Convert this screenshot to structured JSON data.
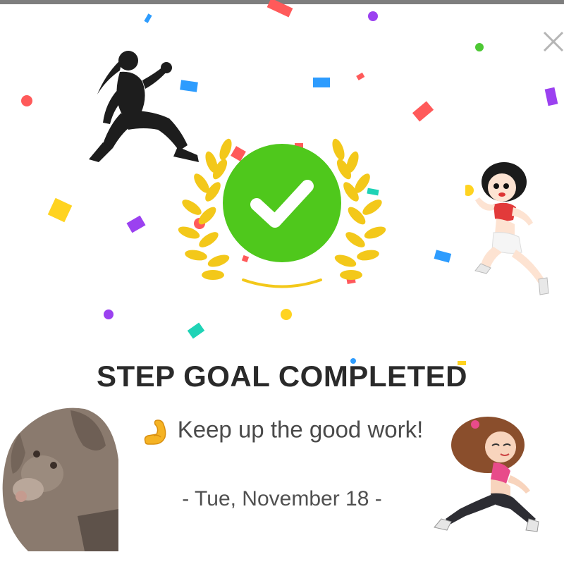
{
  "dialog": {
    "title": "STEP GOAL COMPLETED",
    "message": "Keep up the good work!",
    "date": "- Tue, November 18 -",
    "icons": {
      "close": "close-icon",
      "emoji": "flexed-biceps-emoji",
      "badge": "green-check-laurel-badge"
    }
  },
  "colors": {
    "check_green": "#4fc81c",
    "laurel_gold": "#f3c81a",
    "title_text": "#2a2a2a",
    "body_text": "#4a4a4a",
    "close_gray": "#b5b5b5",
    "confetti": [
      "#ff5a5a",
      "#2d9cfe",
      "#9b41f0",
      "#ffd320",
      "#1fd3b6",
      "#4dc834"
    ]
  }
}
